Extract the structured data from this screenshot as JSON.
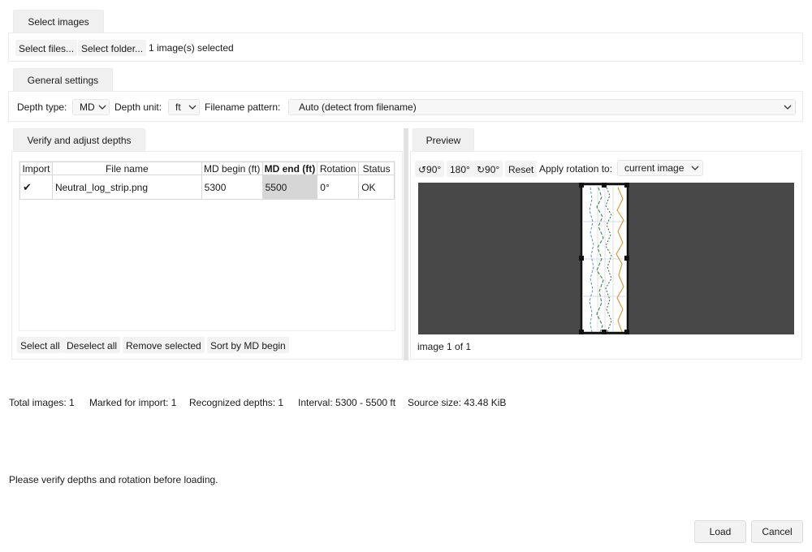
{
  "select_images": {
    "tab_label": "Select images",
    "select_files_label": "Select files...",
    "select_folder_label": "Select folder...",
    "selection_status": "1 image(s) selected"
  },
  "general_settings": {
    "tab_label": "General settings",
    "depth_type_label": "Depth type:",
    "depth_type_value": "MD",
    "depth_unit_label": "Depth unit:",
    "depth_unit_value": "ft",
    "filename_pattern_label": "Filename pattern:",
    "filename_pattern_value": "Auto (detect from filename)"
  },
  "verify": {
    "tab_label": "Verify and adjust depths",
    "columns": [
      "Import",
      "File name",
      "MD begin (ft)",
      "MD end (ft)",
      "Rotation",
      "Status"
    ],
    "rows": [
      {
        "import": "✔",
        "file_name": "Neutral_log_strip.png",
        "md_begin": "5300",
        "md_end": "5500",
        "rotation": "0°",
        "status": "OK"
      }
    ],
    "select_all_label": "Select all",
    "deselect_all_label": "Deselect all",
    "remove_selected_label": "Remove selected",
    "sort_label": "Sort by MD begin"
  },
  "preview": {
    "tab_label": "Preview",
    "rotate_left_label": "↺90°",
    "rotate_180_label": "180°",
    "rotate_right_label": "↻90°",
    "reset_label": "Reset",
    "apply_rotation_label": "Apply rotation to:",
    "apply_rotation_value": "current image",
    "image_counter": "image 1 of 1",
    "canvas_color": "#484848"
  },
  "summary": {
    "total_images": "Total images: 1",
    "marked_for_import": "Marked for import: 1",
    "recognized_depths": "Recognized depths: 1",
    "interval": "Interval: 5300 - 5500 ft",
    "source_size": "Source size: 43.48 KiB"
  },
  "hint": "Please verify depths and rotation before loading.",
  "actions": {
    "load_label": "Load",
    "cancel_label": "Cancel"
  }
}
